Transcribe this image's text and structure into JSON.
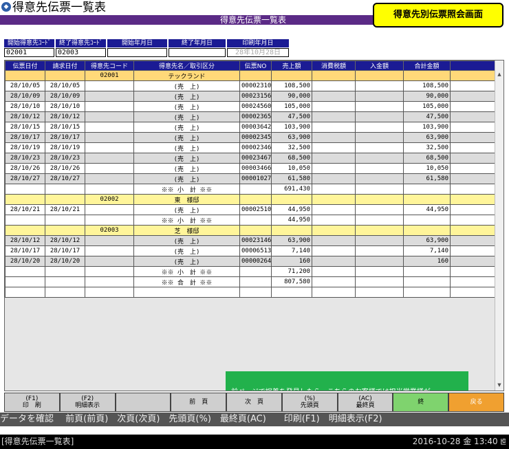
{
  "window": {
    "app_icon": "app-icon",
    "title": "得意先伝票一覧表"
  },
  "subheader": "得意先伝票一覧表",
  "screen_badge": "得意先別伝票照会画面",
  "fields": [
    {
      "label": "開始得意先ｺｰﾄﾞ",
      "value": "02001"
    },
    {
      "label": "終了得意先ｺｰﾄﾞ",
      "value": "02003"
    },
    {
      "label": "開始年月日",
      "value": ""
    },
    {
      "label": "終了年月日",
      "value": ""
    },
    {
      "label": "印刷年月日",
      "value": "28年10月28日"
    }
  ],
  "columns": [
    "伝票日付",
    "請求日付",
    "得意先コード",
    "得意先名／取引区分",
    "伝票NO",
    "売上額",
    "消費税額",
    "入金額",
    "合計金額"
  ],
  "rows": [
    {
      "type": "cust",
      "first": true,
      "code": "02001",
      "name": "テックランド"
    },
    {
      "type": "data",
      "date": "28/10/05",
      "bill": "28/10/05",
      "kubun": "(売　上)",
      "no": "00002310",
      "sales": "108,500",
      "total": "108,500"
    },
    {
      "type": "data",
      "date": "28/10/09",
      "bill": "28/10/09",
      "kubun": "(売　上)",
      "no": "00023156",
      "sales": "90,000",
      "total": "90,000"
    },
    {
      "type": "data",
      "date": "28/10/10",
      "bill": "28/10/10",
      "kubun": "(売　上)",
      "no": "00024560",
      "sales": "105,000",
      "total": "105,000"
    },
    {
      "type": "data",
      "date": "28/10/12",
      "bill": "28/10/12",
      "kubun": "(売　上)",
      "no": "00002365",
      "sales": "47,500",
      "total": "47,500"
    },
    {
      "type": "data",
      "date": "28/10/15",
      "bill": "28/10/15",
      "kubun": "(売　上)",
      "no": "00003642",
      "sales": "103,900",
      "total": "103,900"
    },
    {
      "type": "data",
      "date": "28/10/17",
      "bill": "28/10/17",
      "kubun": "(売　上)",
      "no": "00002345",
      "sales": "63,900",
      "total": "63,900"
    },
    {
      "type": "data",
      "date": "28/10/19",
      "bill": "28/10/19",
      "kubun": "(売　上)",
      "no": "00002346",
      "sales": "32,500",
      "total": "32,500"
    },
    {
      "type": "data",
      "date": "28/10/23",
      "bill": "28/10/23",
      "kubun": "(売　上)",
      "no": "00023467",
      "sales": "68,500",
      "total": "68,500"
    },
    {
      "type": "data",
      "date": "28/10/26",
      "bill": "28/10/26",
      "kubun": "(売　上)",
      "no": "00003466",
      "sales": "10,050",
      "total": "10,050"
    },
    {
      "type": "data",
      "date": "28/10/27",
      "bill": "28/10/27",
      "kubun": "(売　上)",
      "no": "00001027",
      "sales": "61,580",
      "total": "61,580"
    },
    {
      "type": "sub",
      "label": "※※ 小　計 ※※",
      "sales": "691,430"
    },
    {
      "type": "cust",
      "first": false,
      "code": "02002",
      "name": "東　様邸"
    },
    {
      "type": "data",
      "date": "28/10/21",
      "bill": "28/10/21",
      "kubun": "(売　上)",
      "no": "00002510",
      "sales": "44,950",
      "total": "44,950"
    },
    {
      "type": "sub",
      "label": "※※ 小　計 ※※",
      "sales": "44,950"
    },
    {
      "type": "cust",
      "first": false,
      "code": "02003",
      "name": "芝　様邸"
    },
    {
      "type": "data",
      "date": "28/10/12",
      "bill": "28/10/12",
      "kubun": "(売　上)",
      "no": "00023146",
      "sales": "63,900",
      "total": "63,900"
    },
    {
      "type": "data",
      "date": "28/10/17",
      "bill": "28/10/17",
      "kubun": "(売　上)",
      "no": "00006513",
      "sales": "7,140",
      "total": "7,140"
    },
    {
      "type": "data",
      "date": "28/10/20",
      "bill": "28/10/20",
      "kubun": "(売　上)",
      "no": "00000264",
      "sales": "160",
      "total": "160"
    },
    {
      "type": "sub",
      "label": "※※ 小　計 ※※",
      "sales": "71,200"
    },
    {
      "type": "sub",
      "label": "※※ 合　計 ※※",
      "sales": "807,580"
    },
    {
      "type": "empty"
    }
  ],
  "note": "前ページで誤差を発見したら、こちらのお客様では担当営業様が\nそれぞれの現場で納品書を切ってくることもあり、その控えと、\nこの画面の伝票毎の金額をチェックすることで、誤差が生じている\n伝票を画面上で特定することができます。",
  "fkeys": [
    {
      "l1": "(F1)",
      "l2": "印　刷",
      "style": ""
    },
    {
      "l1": "(F2)",
      "l2": "明細表示",
      "style": ""
    },
    {
      "l1": "",
      "l2": "",
      "style": ""
    },
    {
      "l1": "",
      "l2": "前　頁",
      "style": ""
    },
    {
      "l1": "",
      "l2": "次　頁",
      "style": ""
    },
    {
      "l1": "(%)",
      "l2": "先頭頁",
      "style": ""
    },
    {
      "l1": "(AC)",
      "l2": "最終頁",
      "style": ""
    },
    {
      "l1": "",
      "l2": "終",
      "style": "green"
    },
    {
      "l1": "",
      "l2": "戻る",
      "style": "orange"
    }
  ],
  "status_message": "データを確認　 前頁(前頁)　次頁(次頁)　先頭頁(%)　最終頁(AC)　　印刷(F1)　明細表示(F2)",
  "bottom": {
    "screen_name": "[得意先伝票一覧表]",
    "datetime": "2016-10-28 金 13:40 ꡁ"
  }
}
